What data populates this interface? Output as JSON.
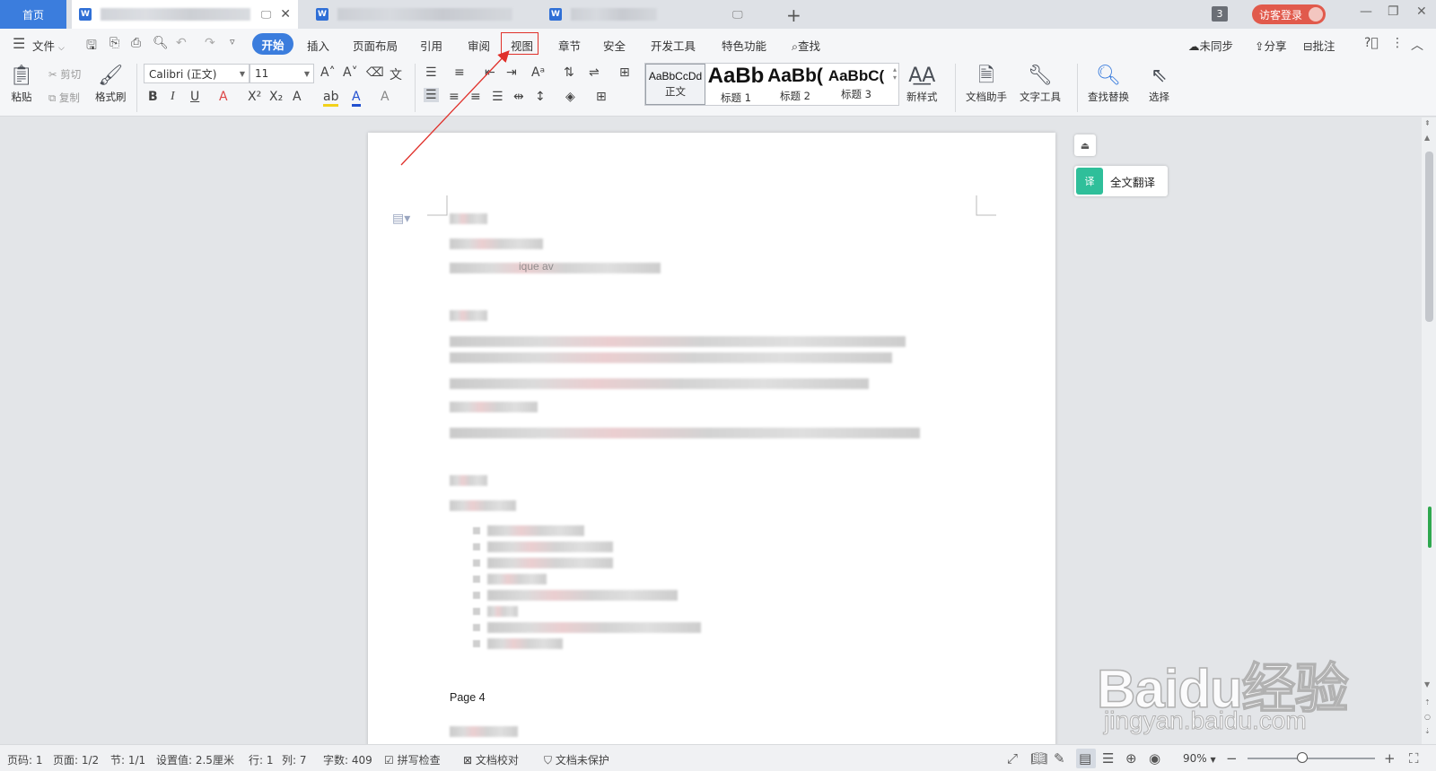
{
  "tabs": {
    "home": "首页",
    "w_icon": "W",
    "doc_tabs": [
      {
        "active": true
      },
      {
        "active": false
      },
      {
        "active": false
      }
    ],
    "tab_mini_icon": "monitor-icon",
    "close_glyph": "✕",
    "add_glyph": "+"
  },
  "account": {
    "count": "3",
    "guest_login": "访客登录"
  },
  "window": {
    "minimize": "—",
    "restore": "❐",
    "close": "✕"
  },
  "menu": {
    "file": "文件",
    "start": "开始",
    "insert": "插入",
    "page_layout": "页面布局",
    "references": "引用",
    "review": "审阅",
    "view": "视图",
    "chapter": "章节",
    "security": "安全",
    "developer": "开发工具",
    "features": "特色功能",
    "search": "查找",
    "unsynced": "未同步",
    "share": "分享",
    "annotate": "批注"
  },
  "ribbon": {
    "paste": "粘贴",
    "cut": "剪切",
    "copy": "复制",
    "format_painter": "格式刷",
    "font_name": "Calibri (正文)",
    "font_size": "11",
    "styles": [
      {
        "preview": "AaBbCcDd",
        "name": "正文"
      },
      {
        "preview": "AaBb",
        "name": "标题 1"
      },
      {
        "preview": "AaBb(",
        "name": "标题 2"
      },
      {
        "preview": "AaBbC(",
        "name": "标题 3"
      }
    ],
    "new_style": "新样式",
    "doc_assistant": "文档助手",
    "text_tools": "文字工具",
    "find_replace": "查找替换",
    "select": "选择"
  },
  "document": {
    "visible_fragment": "ique av",
    "page_label": "Page 4"
  },
  "side_panel": {
    "translate": "全文翻译"
  },
  "status": {
    "page": "页码: 1",
    "pages": "页面: 1/2",
    "section": "节: 1/1",
    "setting": "设置值: 2.5厘米",
    "row": "行: 1",
    "col": "列: 7",
    "words": "字数: 409",
    "spell": "拼写检查",
    "proof": "文档校对",
    "protect": "文档未保护",
    "zoom": "90%"
  },
  "watermark": {
    "main": "Baidu经验",
    "sub": "jingyan.baidu.com"
  },
  "colors": {
    "accent": "#3b7ddd",
    "highlight_box": "#e0302a",
    "guest_btn": "#e15a4c",
    "translate_icon": "#2fbf9a"
  }
}
